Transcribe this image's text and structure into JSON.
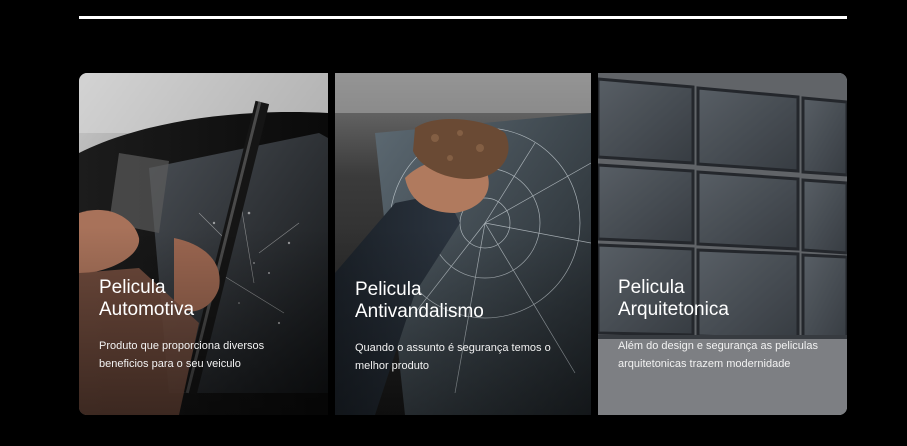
{
  "cards": [
    {
      "title_line1": "Pelicula",
      "title_line2": "Automotiva",
      "description": "Produto que proporciona diversos beneficios para o seu veiculo"
    },
    {
      "title_line1": "Pelicula",
      "title_line2": "Antivandalismo",
      "description": "Quando o assunto é segurança temos o melhor produto"
    },
    {
      "title_line1": "Pelicula",
      "title_line2": "Arquitetonica",
      "description": "Além do design e segurança as peliculas arquitetonicas trazem modernidade"
    }
  ],
  "colors": {
    "page_background": "#000000",
    "divider": "#ffffff",
    "text": "#ffffff"
  }
}
